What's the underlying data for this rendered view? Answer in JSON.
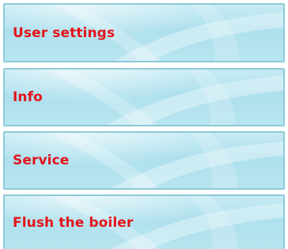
{
  "menu": {
    "items": [
      {
        "label": "User settings"
      },
      {
        "label": "Info"
      },
      {
        "label": "Service"
      },
      {
        "label": "Flush the boiler"
      }
    ]
  },
  "colors": {
    "label_text": "#e3141b",
    "tile_border": "#8ec9d8",
    "tile_light": "#c7ebf4",
    "tile_mid": "#aee0ed"
  }
}
